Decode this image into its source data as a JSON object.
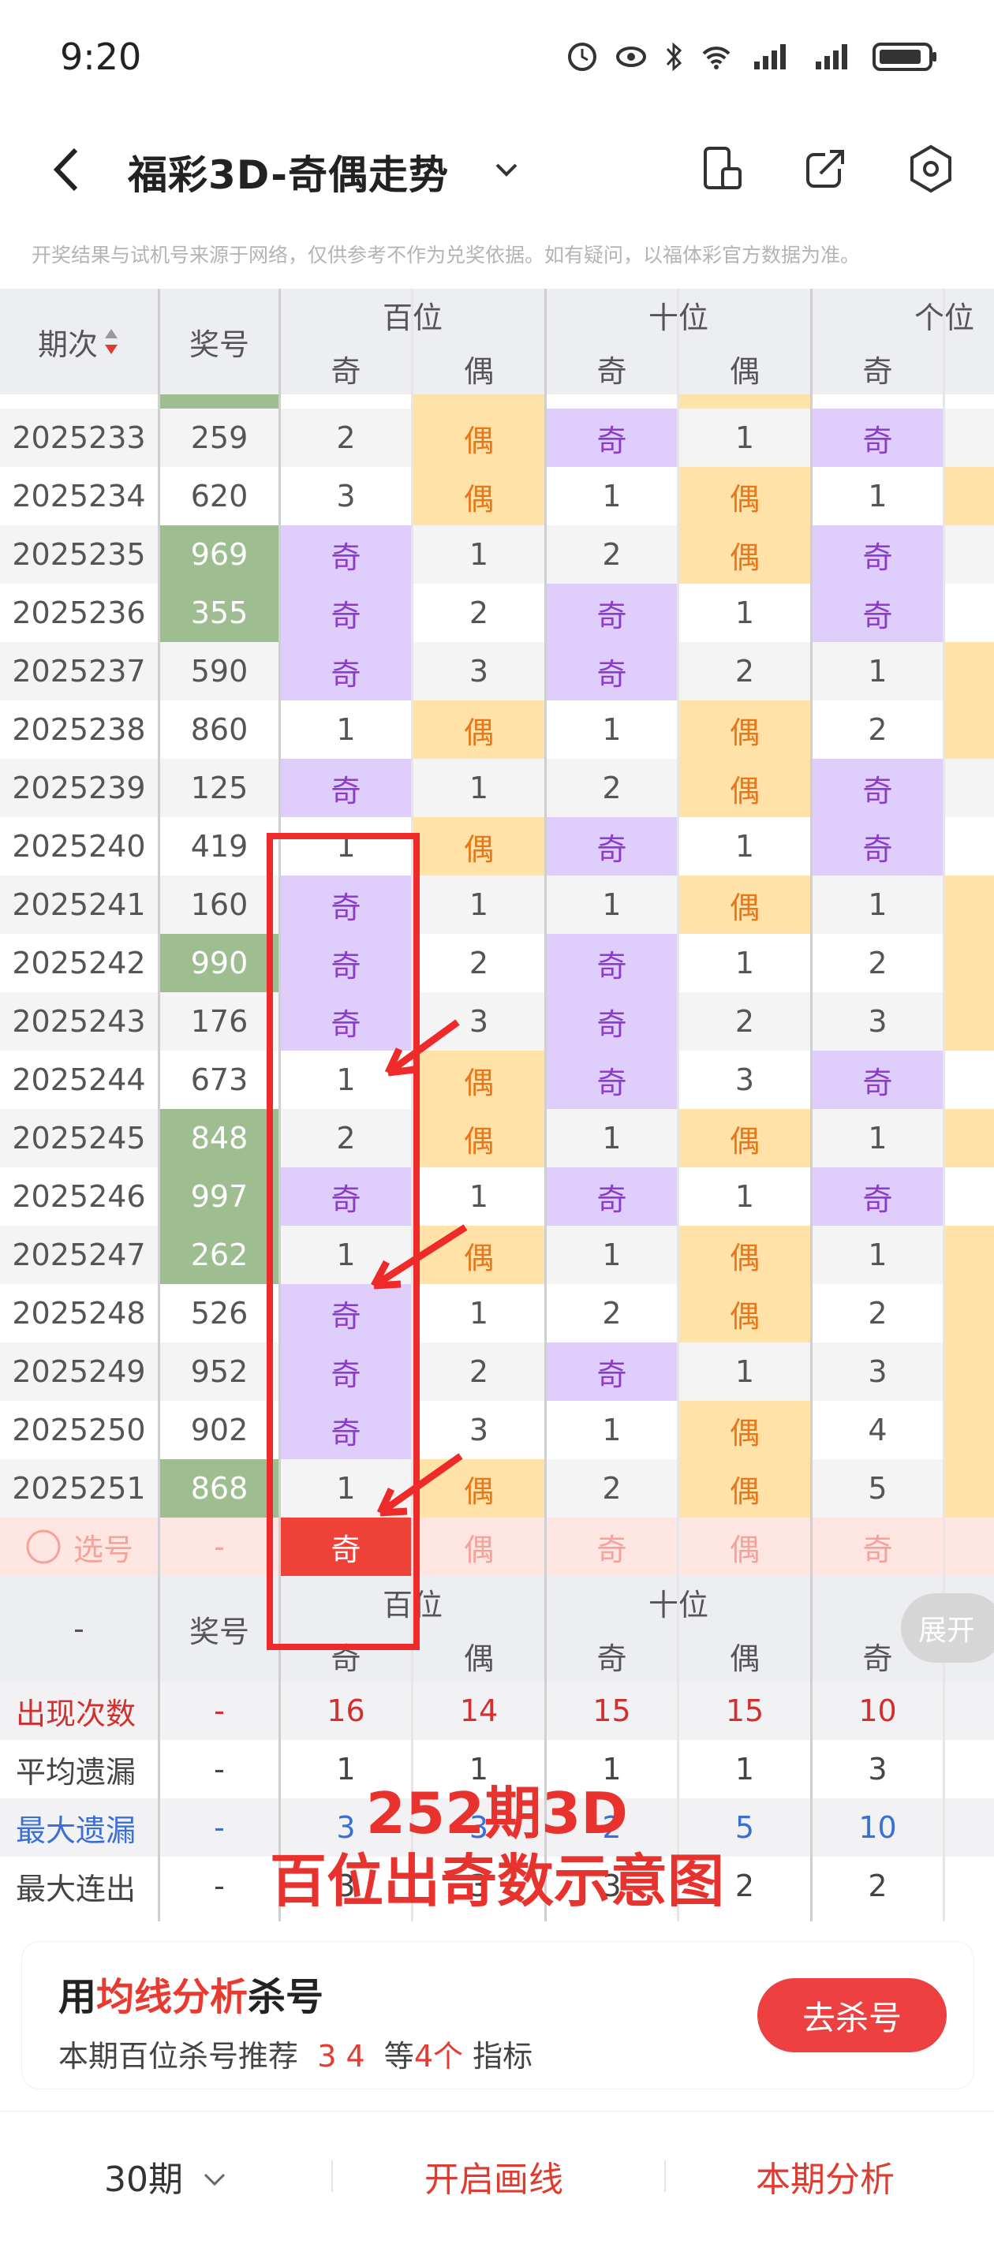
{
  "status_bar": {
    "time": "9:20"
  },
  "header": {
    "title": "福彩3D-奇偶走势"
  },
  "notice": "开奖结果与试机号来源于网络，仅供参考不作为兑奖依据。如有疑问，以福体彩官方数据为准。",
  "table": {
    "col_issue": "期次",
    "col_number": "奖号",
    "groups": [
      "百位",
      "十位",
      "个位"
    ],
    "sub": {
      "odd": "奇",
      "even": "偶"
    },
    "rows": [
      {
        "issue": "2025233",
        "num": "259",
        "hl": false,
        "cells": [
          "2",
          "偶",
          "奇",
          "1",
          "奇"
        ]
      },
      {
        "issue": "2025234",
        "num": "620",
        "hl": false,
        "cells": [
          "3",
          "偶",
          "1",
          "偶",
          "1"
        ]
      },
      {
        "issue": "2025235",
        "num": "969",
        "hl": true,
        "cells": [
          "奇",
          "1",
          "2",
          "偶",
          "奇"
        ]
      },
      {
        "issue": "2025236",
        "num": "355",
        "hl": true,
        "cells": [
          "奇",
          "2",
          "奇",
          "1",
          "奇"
        ]
      },
      {
        "issue": "2025237",
        "num": "590",
        "hl": false,
        "cells": [
          "奇",
          "3",
          "奇",
          "2",
          "1"
        ]
      },
      {
        "issue": "2025238",
        "num": "860",
        "hl": false,
        "cells": [
          "1",
          "偶",
          "1",
          "偶",
          "2"
        ]
      },
      {
        "issue": "2025239",
        "num": "125",
        "hl": false,
        "cells": [
          "奇",
          "1",
          "2",
          "偶",
          "奇"
        ]
      },
      {
        "issue": "2025240",
        "num": "419",
        "hl": false,
        "cells": [
          "1",
          "偶",
          "奇",
          "1",
          "奇"
        ]
      },
      {
        "issue": "2025241",
        "num": "160",
        "hl": false,
        "cells": [
          "奇",
          "1",
          "1",
          "偶",
          "1"
        ]
      },
      {
        "issue": "2025242",
        "num": "990",
        "hl": true,
        "cells": [
          "奇",
          "2",
          "奇",
          "1",
          "2"
        ]
      },
      {
        "issue": "2025243",
        "num": "176",
        "hl": false,
        "cells": [
          "奇",
          "3",
          "奇",
          "2",
          "3"
        ]
      },
      {
        "issue": "2025244",
        "num": "673",
        "hl": false,
        "cells": [
          "1",
          "偶",
          "奇",
          "3",
          "奇"
        ]
      },
      {
        "issue": "2025245",
        "num": "848",
        "hl": true,
        "cells": [
          "2",
          "偶",
          "1",
          "偶",
          "1"
        ]
      },
      {
        "issue": "2025246",
        "num": "997",
        "hl": true,
        "cells": [
          "奇",
          "1",
          "奇",
          "1",
          "奇"
        ]
      },
      {
        "issue": "2025247",
        "num": "262",
        "hl": true,
        "cells": [
          "1",
          "偶",
          "1",
          "偶",
          "1"
        ]
      },
      {
        "issue": "2025248",
        "num": "526",
        "hl": false,
        "cells": [
          "奇",
          "1",
          "2",
          "偶",
          "2"
        ]
      },
      {
        "issue": "2025249",
        "num": "952",
        "hl": false,
        "cells": [
          "奇",
          "2",
          "奇",
          "1",
          "3"
        ]
      },
      {
        "issue": "2025250",
        "num": "902",
        "hl": false,
        "cells": [
          "奇",
          "3",
          "1",
          "偶",
          "4"
        ]
      },
      {
        "issue": "2025251",
        "num": "868",
        "hl": true,
        "cells": [
          "1",
          "偶",
          "2",
          "偶",
          "5"
        ]
      }
    ],
    "pick_row": {
      "label": "选号",
      "num": "-",
      "cells": [
        "奇",
        "偶",
        "奇",
        "偶",
        "奇"
      ]
    },
    "footer_header": {
      "dash": "-",
      "num": "奖号",
      "groups": [
        "百位",
        "十位"
      ],
      "sub": [
        "奇",
        "偶",
        "奇",
        "偶",
        "奇"
      ]
    },
    "stats": [
      {
        "label": "出现次数",
        "num": "-",
        "vals": [
          "16",
          "14",
          "15",
          "15",
          "10"
        ],
        "color": "red"
      },
      {
        "label": "平均遗漏",
        "num": "-",
        "vals": [
          "1",
          "1",
          "1",
          "1",
          "3"
        ],
        "color": "dark"
      },
      {
        "label": "最大遗漏",
        "num": "-",
        "vals": [
          "3",
          "3",
          "2",
          "5",
          "10"
        ],
        "color": "blue"
      },
      {
        "label": "最大连出",
        "num": "-",
        "vals": [
          "3",
          "3",
          "3",
          "2",
          "2"
        ],
        "color": "dark"
      }
    ],
    "expand_label": "展开"
  },
  "overlay": {
    "line1": "252期3D",
    "line2": "百位出奇数示意图"
  },
  "promo": {
    "title_pre": "用",
    "title_hl": "均线分析",
    "title_post": "杀号",
    "sub_pre": "本期百位杀号推荐",
    "sub_nums": "3 4",
    "sub_mid": "等",
    "sub_count": "4个",
    "sub_post": "指标",
    "button": "去杀号"
  },
  "bottom_bar": {
    "periods": "30期",
    "draw_line": "开启画线",
    "analysis": "本期分析"
  },
  "colors": {
    "odd_bg": "#dfcdfb",
    "even_bg": "#ffe2a8",
    "accent": "#ee4238",
    "number_bg": "#9ebe92"
  }
}
